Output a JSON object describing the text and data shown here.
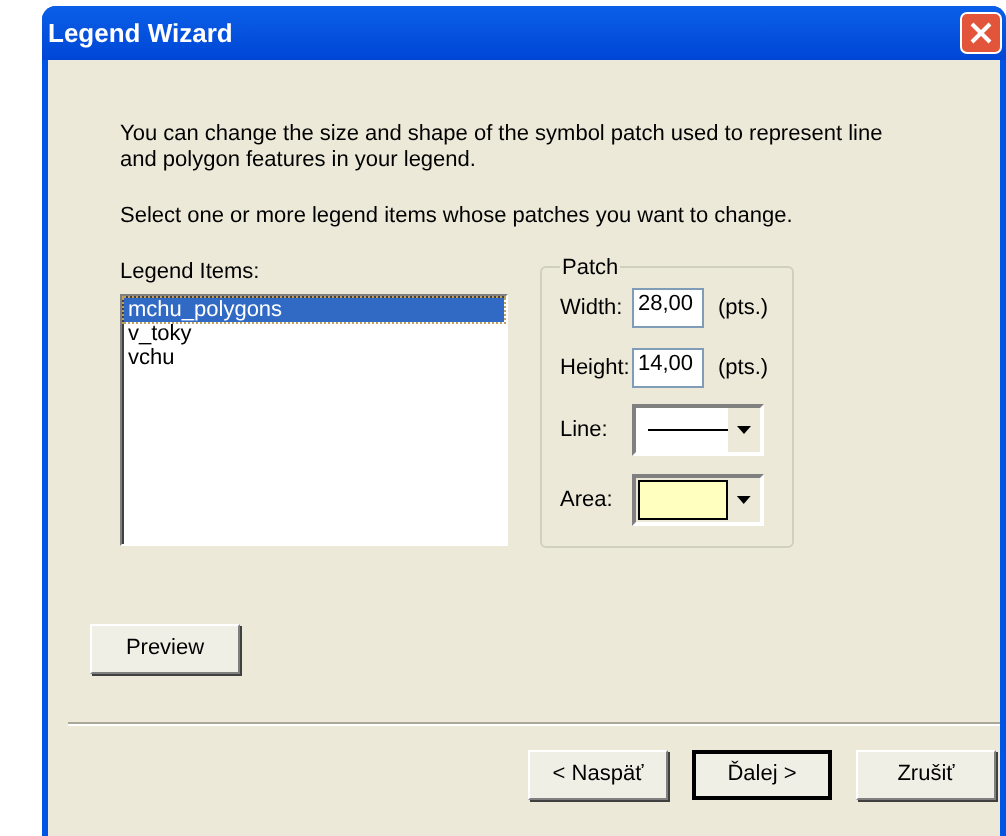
{
  "window": {
    "title": "Legend Wizard"
  },
  "intro": "You can change the size and shape of the symbol patch used to represent line and polygon features in your legend.",
  "instruction": "Select one or more legend items whose patches you want to change.",
  "legend_items": {
    "label": "Legend Items:",
    "items": [
      {
        "label": "mchu_polygons",
        "selected": true
      },
      {
        "label": "v_toky",
        "selected": false
      },
      {
        "label": "vchu",
        "selected": false
      }
    ]
  },
  "patch": {
    "title": "Patch",
    "width": {
      "label": "Width:",
      "value": "28,00",
      "unit": "(pts.)"
    },
    "height": {
      "label": "Height:",
      "value": "14,00",
      "unit": "(pts.)"
    },
    "line": {
      "label": "Line:"
    },
    "area": {
      "label": "Area:",
      "color": "#ffffc0"
    }
  },
  "preview_button": "Preview",
  "buttons": [
    {
      "label": "< Naspäť",
      "default": false
    },
    {
      "label": "Ďalej >",
      "default": true
    },
    {
      "label": "Zrušiť",
      "default": false
    }
  ]
}
